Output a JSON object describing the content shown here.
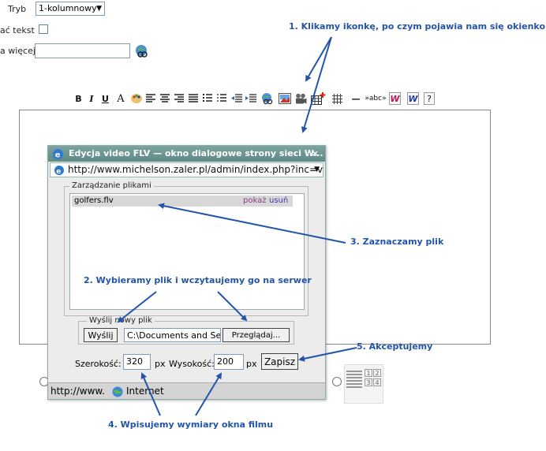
{
  "form": {
    "tryb_label": "Tryb",
    "tryb_value": "1-kolumnowy",
    "checkbox_label": "ać tekst",
    "more_label": "a więcej"
  },
  "toolbar": {
    "bold": "B",
    "italic": "I",
    "underline": "U",
    "font_color": "A",
    "hr": "—",
    "spellcheck": "»abc»",
    "word1": "W",
    "word2": "W",
    "help": "?"
  },
  "popup": {
    "title": "Edycja video FLV — okno dialogowe strony sieci W...",
    "address": "http://www.michelson.zaler.pl/admin/index.php?inc=vi",
    "files_legend": "Zarządzanie plikami",
    "file_name": "golfers.flv",
    "show_link": "pokaż",
    "delete_link": "usuń",
    "upload_legend": "Wyślij nowy plik",
    "send_button": "Wyślij",
    "file_path": "C:\\Documents and Se",
    "browse_button": "Przeglądaj...",
    "width_label": "Szerokość:",
    "width_value": "320",
    "width_unit": "px",
    "height_label": "Wysokość:",
    "height_value": "200",
    "height_unit": "px",
    "save_button": "Zapisz",
    "status_url": "http://www.",
    "status_zone": "Internet"
  },
  "layout_cells": [
    "1",
    "2",
    "3",
    "4"
  ],
  "annotations": {
    "step1": "1. Klikamy ikonkę, po czym pojawia nam się okienko",
    "step2": "2. Wybieramy plik i wczytaujemy go na serwer",
    "step3": "3. Zaznaczamy plik",
    "step4": "4.  Wpisujemy wymiary okna filmu",
    "step5": "5. Akceptujemy"
  },
  "colors": {
    "annotation": "#2255aa",
    "title_bar": "#6f9794",
    "show_link": "#8a3f7d",
    "delete_link": "#4433aa"
  }
}
